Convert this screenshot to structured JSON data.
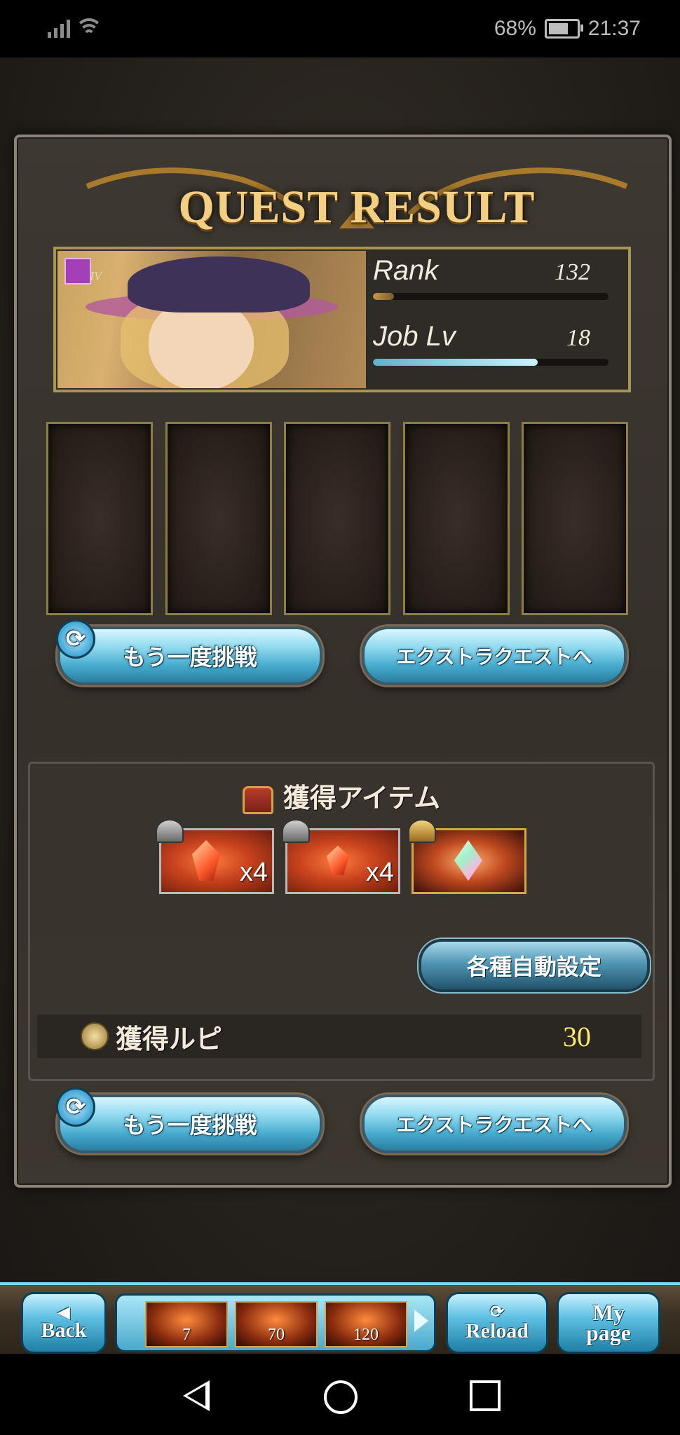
{
  "status_bar": {
    "battery_text": "68%",
    "time": "21:37",
    "battery_level": 0.68
  },
  "title": "QUEST RESULT",
  "profile": {
    "class_badge": "IV",
    "rank_label": "Rank",
    "rank_value": "132",
    "rank_progress": 0.09,
    "joblv_label": "Job Lv",
    "joblv_value": "18",
    "joblv_progress": 0.7
  },
  "buttons": {
    "retry": "もう一度挑戦",
    "extra_quest": "エクストラクエストへ"
  },
  "items": {
    "header": "獲得アイテム",
    "list": [
      {
        "qty": "x4",
        "cap": "silver"
      },
      {
        "qty": "x4",
        "cap": "silver"
      },
      {
        "qty": "",
        "cap": "gold"
      }
    ],
    "auto_settings": "各種自動設定",
    "rupie_label": "獲得ルピ",
    "rupie_value": "30"
  },
  "bottom_nav": {
    "back": "Back",
    "reload": "Reload",
    "mypage_line1": "My",
    "mypage_line2": "page",
    "items": [
      "7",
      "70",
      "120"
    ]
  },
  "colors": {
    "accent_blue": "#44a9cc",
    "rupie_yellow": "#ffe86b",
    "frame_gold": "#a89552"
  }
}
